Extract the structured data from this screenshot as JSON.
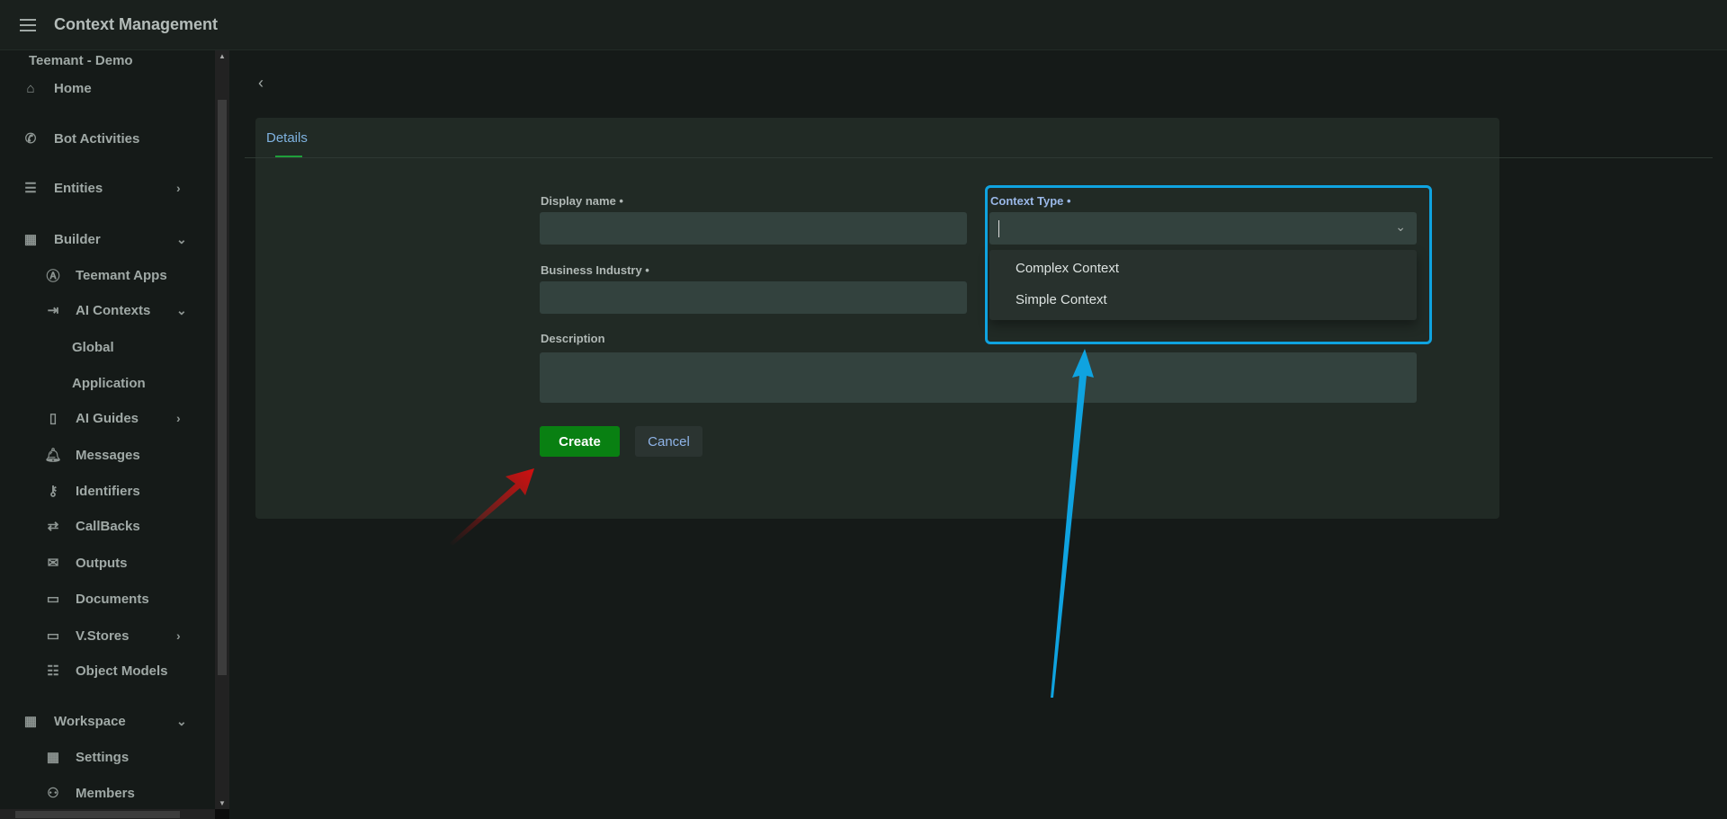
{
  "header": {
    "title": "Context Management",
    "menu_icon": "hamburger-icon"
  },
  "sidebar": {
    "tenant": "Teemant - Demo",
    "items": [
      {
        "label": "Home",
        "icon": "home-icon"
      },
      {
        "label": "Bot Activities",
        "icon": "whatsapp-icon"
      },
      {
        "label": "Entities",
        "icon": "document-icon",
        "chevron": "right"
      },
      {
        "label": "Builder",
        "icon": "building-icon",
        "chevron": "down"
      },
      {
        "label": "Teemant Apps",
        "icon": "app-store-icon"
      },
      {
        "label": "AI Contexts",
        "icon": "enter-icon",
        "chevron": "down"
      },
      {
        "label": "Global"
      },
      {
        "label": "Application"
      },
      {
        "label": "AI Guides",
        "icon": "book-open-icon",
        "chevron": "right"
      },
      {
        "label": "Messages",
        "icon": "bell-icon"
      },
      {
        "label": "Identifiers",
        "icon": "key-icon"
      },
      {
        "label": "CallBacks",
        "icon": "callback-icon"
      },
      {
        "label": "Outputs",
        "icon": "envelope-open-icon"
      },
      {
        "label": "Documents",
        "icon": "book-icon"
      },
      {
        "label": "V.Stores",
        "icon": "book-icon",
        "chevron": "right"
      },
      {
        "label": "Object Models",
        "icon": "layers-icon"
      },
      {
        "label": "Workspace",
        "icon": "building-icon",
        "chevron": "down"
      },
      {
        "label": "Settings",
        "icon": "building-icon"
      },
      {
        "label": "Members",
        "icon": "user-icon"
      }
    ]
  },
  "main": {
    "tabs": [
      {
        "label": "Details",
        "active": true
      }
    ],
    "form": {
      "display_name": {
        "label": "Display name •",
        "value": ""
      },
      "business_industry": {
        "label": "Business Industry •",
        "value": ""
      },
      "description": {
        "label": "Description",
        "value": ""
      },
      "context_type": {
        "label": "Context Type •",
        "value": "",
        "options": [
          "Complex Context",
          "Simple Context"
        ]
      }
    },
    "buttons": {
      "create": "Create",
      "cancel": "Cancel"
    }
  },
  "colors": {
    "accent_green": "#098012",
    "highlight_blue": "#0fa3e0",
    "arrow_red": "#d01010",
    "tab_blue": "#7fb2e0"
  }
}
